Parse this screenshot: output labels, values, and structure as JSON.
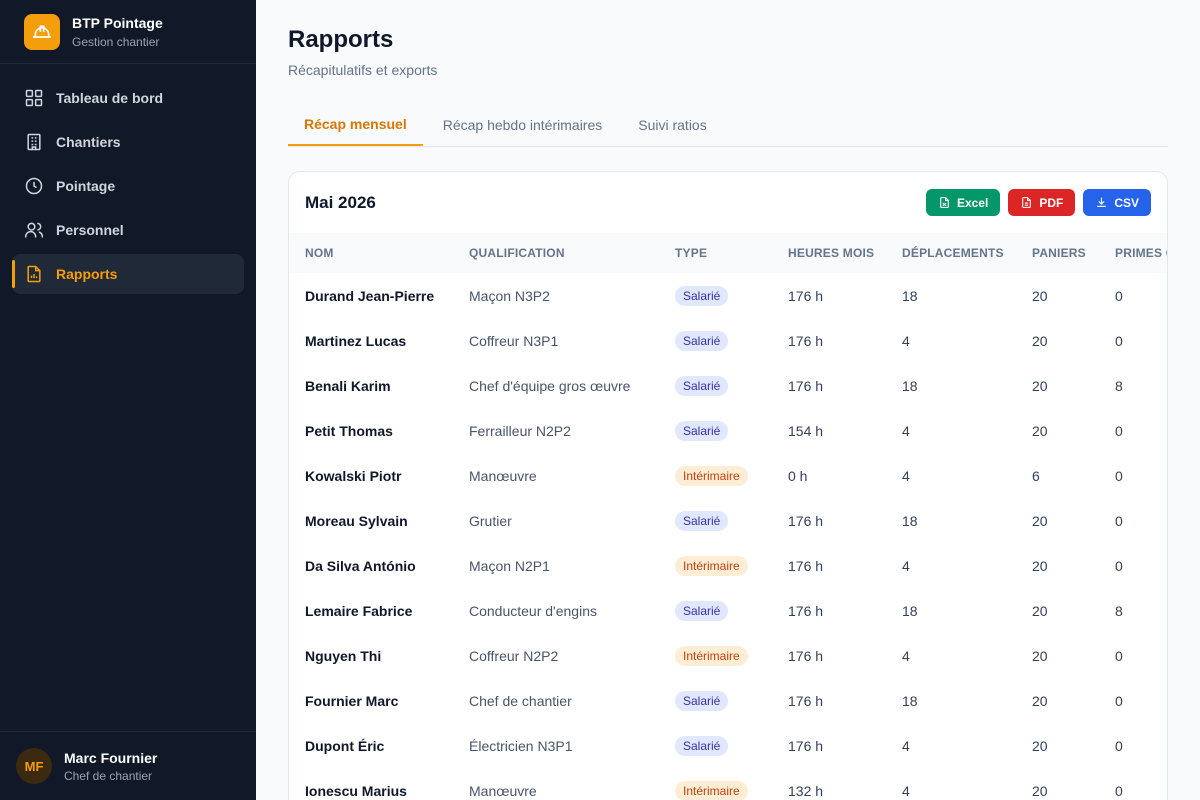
{
  "brand": {
    "title": "BTP Pointage",
    "subtitle": "Gestion chantier",
    "logo_icon": "hard-hat-icon"
  },
  "nav": [
    {
      "label": "Tableau de bord",
      "icon": "dashboard-icon",
      "active": false
    },
    {
      "label": "Chantiers",
      "icon": "building-icon",
      "active": false
    },
    {
      "label": "Pointage",
      "icon": "clock-icon",
      "active": false
    },
    {
      "label": "Personnel",
      "icon": "users-icon",
      "active": false
    },
    {
      "label": "Rapports",
      "icon": "report-icon",
      "active": true
    }
  ],
  "user": {
    "initials": "MF",
    "name": "Marc Fournier",
    "role": "Chef de chantier"
  },
  "page": {
    "title": "Rapports",
    "subtitle": "Récapitulatifs et exports"
  },
  "tabs": [
    {
      "label": "Récap mensuel",
      "active": true
    },
    {
      "label": "Récap hebdo intérimaires",
      "active": false
    },
    {
      "label": "Suivi ratios",
      "active": false
    }
  ],
  "card": {
    "title": "Mai 2026",
    "buttons": {
      "excel": "Excel",
      "pdf": "PDF",
      "csv": "CSV"
    }
  },
  "table": {
    "columns": [
      "Nom",
      "Qualification",
      "Type",
      "Heures mois",
      "Déplacements",
      "Paniers",
      "Primes c"
    ],
    "rows": [
      [
        "Durand Jean-Pierre",
        "Maçon N3P2",
        "Salarié",
        "176 h",
        "18",
        "20",
        "0"
      ],
      [
        "Martinez Lucas",
        "Coffreur N3P1",
        "Salarié",
        "176 h",
        "4",
        "20",
        "0"
      ],
      [
        "Benali Karim",
        "Chef d'équipe gros œuvre",
        "Salarié",
        "176 h",
        "18",
        "20",
        "8"
      ],
      [
        "Petit Thomas",
        "Ferrailleur N2P2",
        "Salarié",
        "154 h",
        "4",
        "20",
        "0"
      ],
      [
        "Kowalski Piotr",
        "Manœuvre",
        "Intérimaire",
        "0 h",
        "4",
        "6",
        "0"
      ],
      [
        "Moreau Sylvain",
        "Grutier",
        "Salarié",
        "176 h",
        "18",
        "20",
        "0"
      ],
      [
        "Da Silva António",
        "Maçon N2P1",
        "Intérimaire",
        "176 h",
        "4",
        "20",
        "0"
      ],
      [
        "Lemaire Fabrice",
        "Conducteur d'engins",
        "Salarié",
        "176 h",
        "18",
        "20",
        "8"
      ],
      [
        "Nguyen Thi",
        "Coffreur N2P2",
        "Intérimaire",
        "176 h",
        "4",
        "20",
        "0"
      ],
      [
        "Fournier Marc",
        "Chef de chantier",
        "Salarié",
        "176 h",
        "18",
        "20",
        "0"
      ],
      [
        "Dupont Éric",
        "Électricien N3P1",
        "Salarié",
        "176 h",
        "4",
        "20",
        "0"
      ],
      [
        "Ionescu Marius",
        "Manœuvre",
        "Intérimaire",
        "132 h",
        "4",
        "20",
        "0"
      ]
    ]
  },
  "colors": {
    "sidebar_bg": "#111827",
    "accent": "#f59e0b",
    "excel": "#059669",
    "pdf": "#dc2626",
    "csv": "#2563eb"
  }
}
